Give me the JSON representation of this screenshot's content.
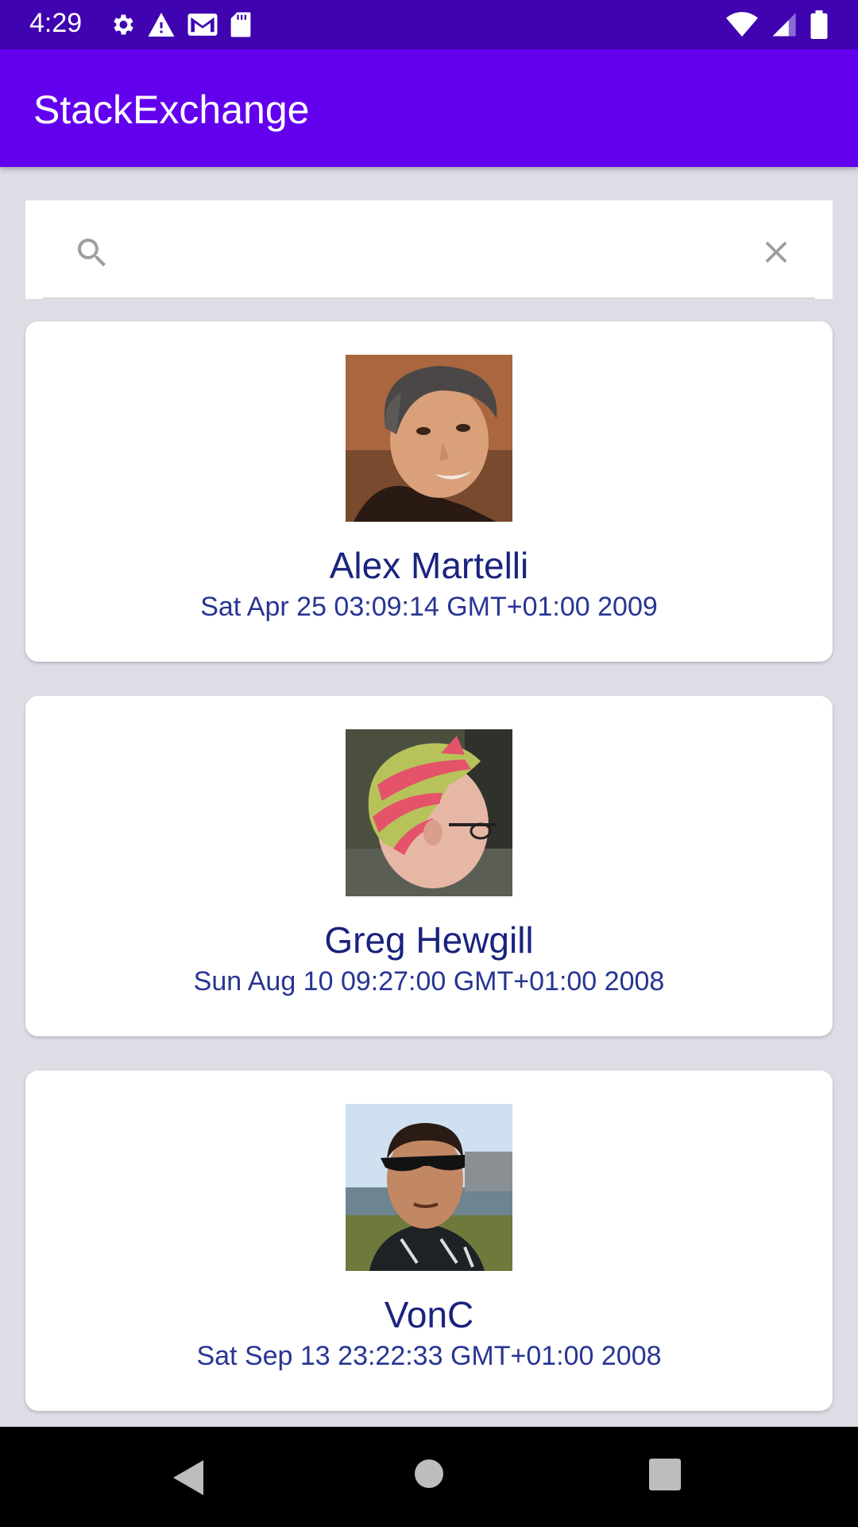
{
  "status_bar": {
    "time": "4:29",
    "left_icons": [
      "settings-icon",
      "warning-icon",
      "gmail-icon",
      "sd-card-icon"
    ],
    "right_icons": [
      "wifi-icon",
      "signal-icon",
      "battery-icon"
    ]
  },
  "app_bar": {
    "title": "StackExchange",
    "color": "#6200EE"
  },
  "search": {
    "value": "",
    "placeholder": ""
  },
  "users": [
    {
      "name": "Alex Martelli",
      "date": "Sat Apr 25 03:09:14 GMT+01:00 2009",
      "avatar": "avatar-alex-martelli"
    },
    {
      "name": "Greg Hewgill",
      "date": "Sun Aug 10 09:27:00 GMT+01:00 2008",
      "avatar": "avatar-greg-hewgill"
    },
    {
      "name": "VonC",
      "date": "Sat Sep 13 23:22:33 GMT+01:00 2008",
      "avatar": "avatar-vonc"
    }
  ],
  "colors": {
    "status_bar": "#3F03B0",
    "name_text": "#1A237E",
    "date_text": "#283593",
    "background": "#DDDDE6"
  },
  "nav_bar": {
    "buttons": [
      "back-icon",
      "home-icon",
      "recents-icon"
    ]
  }
}
